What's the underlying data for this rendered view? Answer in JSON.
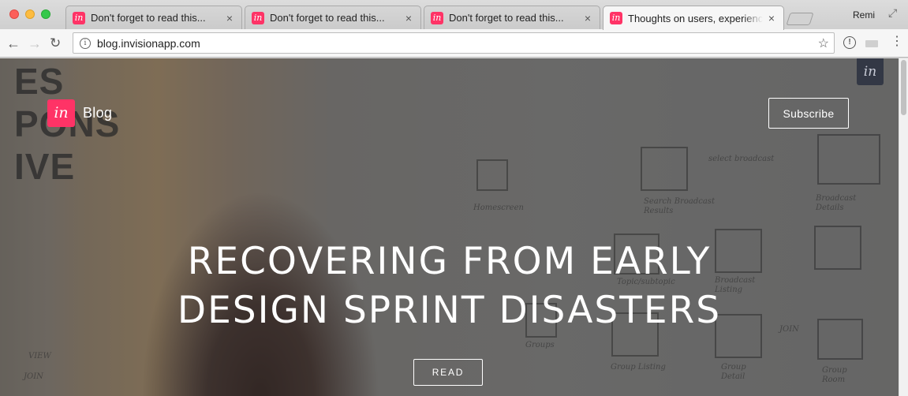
{
  "browser": {
    "tabs": [
      {
        "title": "Don't forget to read this...",
        "active": false
      },
      {
        "title": "Don't forget to read this...",
        "active": false
      },
      {
        "title": "Don't forget to read this...",
        "active": false
      },
      {
        "title": "Thoughts on users, experience",
        "active": true
      }
    ],
    "favicon_glyph": "in",
    "close_glyph": "×",
    "profile_name": "Remi",
    "url": "blog.invisionapp.com",
    "colors": {
      "brand": "#ff3366"
    }
  },
  "site": {
    "logo_glyph": "in",
    "corner_badge": "in",
    "nav_label": "Blog",
    "subscribe_label": "Subscribe",
    "headline_lines": [
      "RECOVERING FROM EARLY",
      "DESIGN SPRINT DISASTERS"
    ],
    "read_label": "READ"
  },
  "background": {
    "poster_lines": [
      "ES",
      "PONS",
      "IVE"
    ],
    "whiteboard_notes": [
      "Homescreen",
      "Search Broadcast Results",
      "select broadcast",
      "Broadcast Details",
      "Topic/subtopic",
      "Broadcast Listing",
      "Groups",
      "Group Listing",
      "Group Detail",
      "Group Room",
      "JOIN",
      "VIEW",
      "JOIN"
    ]
  }
}
